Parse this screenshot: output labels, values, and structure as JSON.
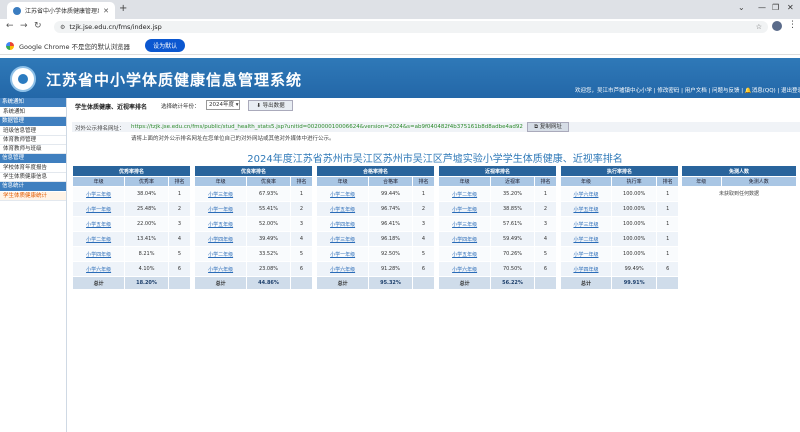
{
  "browser": {
    "tab_title": "江苏省中小学体质健康管理系...",
    "url": "tzjk.jse.edu.cn/fms/index.jsp",
    "infobar_message": "Google Chrome 不是您的默认浏览器",
    "infobar_button": "设为默认"
  },
  "app": {
    "title": "江苏省中小学体质健康信息管理系统",
    "userline": "欢迎您，吴江市芦墟镇中心小学 | 修改密码 | 用户文档 | 问题与反馈 | 🔔消息(QQ) | 退出登录"
  },
  "sidebar": {
    "sections": [
      {
        "head": "系统通知",
        "items": [
          "系统通知"
        ]
      },
      {
        "head": "数据管理",
        "items": [
          "班级信息管理",
          "体育教师管理",
          "体育教师与班级"
        ]
      },
      {
        "head": "信息管理",
        "items": [
          "学校体育年度报告",
          "学生体质健康信息"
        ]
      },
      {
        "head": "信息统计",
        "items": [
          "学生体质健康统计"
        ]
      }
    ]
  },
  "main": {
    "breadcrumb": "学生体质健康、近视率排名",
    "year_label": "选择统计年份：",
    "year_value": "2024年度",
    "export_button": "⬇ 导出数据",
    "url_label": "对外公示排名网址：",
    "url_value": "https://tzjk.jse.edu.cn/fms/public/stud_health_stats5.jsp?unitid=002000010006624&version=2024&s=ab9f040482f4b375161b8d8adbe4ad92",
    "copy_button": "复制网址",
    "url_note": "请将上面的对外公示排名网址在您单位自己的对外网站或其他对外媒体中进行公示。",
    "report_title": "2024年度江苏省苏州市吴江区苏州市吴江区芦墟实验小学学生体质健康、近视率排名"
  },
  "tables": [
    {
      "caption": "优秀率排名",
      "cols": [
        "年级",
        "优秀率",
        "排名"
      ],
      "rows": [
        [
          "小学三年级",
          "38.04%",
          "1"
        ],
        [
          "小学一年级",
          "25.48%",
          "2"
        ],
        [
          "小学五年级",
          "22.00%",
          "3"
        ],
        [
          "小学二年级",
          "13.41%",
          "4"
        ],
        [
          "小学四年级",
          "8.21%",
          "5"
        ],
        [
          "小学六年级",
          "4.10%",
          "6"
        ]
      ],
      "total": [
        "总计",
        "18.20%",
        ""
      ]
    },
    {
      "caption": "优良率排名",
      "cols": [
        "年级",
        "优良率",
        "排名"
      ],
      "rows": [
        [
          "小学三年级",
          "67.93%",
          "1"
        ],
        [
          "小学一年级",
          "55.41%",
          "2"
        ],
        [
          "小学五年级",
          "52.00%",
          "3"
        ],
        [
          "小学四年级",
          "39.49%",
          "4"
        ],
        [
          "小学二年级",
          "33.52%",
          "5"
        ],
        [
          "小学六年级",
          "23.08%",
          "6"
        ]
      ],
      "total": [
        "总计",
        "44.86%",
        ""
      ]
    },
    {
      "caption": "合格率排名",
      "cols": [
        "年级",
        "合格率",
        "排名"
      ],
      "rows": [
        [
          "小学二年级",
          "99.44%",
          "1"
        ],
        [
          "小学五年级",
          "96.74%",
          "2"
        ],
        [
          "小学四年级",
          "96.41%",
          "3"
        ],
        [
          "小学三年级",
          "96.18%",
          "4"
        ],
        [
          "小学一年级",
          "92.50%",
          "5"
        ],
        [
          "小学六年级",
          "91.28%",
          "6"
        ]
      ],
      "total": [
        "总计",
        "95.32%",
        ""
      ]
    },
    {
      "caption": "近视率排名",
      "cols": [
        "年级",
        "近视率",
        "排名"
      ],
      "rows": [
        [
          "小学二年级",
          "35.20%",
          "1"
        ],
        [
          "小学一年级",
          "38.85%",
          "2"
        ],
        [
          "小学三年级",
          "57.61%",
          "3"
        ],
        [
          "小学四年级",
          "59.49%",
          "4"
        ],
        [
          "小学五年级",
          "70.26%",
          "5"
        ],
        [
          "小学六年级",
          "70.50%",
          "6"
        ]
      ],
      "total": [
        "总计",
        "56.22%",
        ""
      ]
    },
    {
      "caption": "执行率排名",
      "cols": [
        "年级",
        "执行率",
        "排名"
      ],
      "rows": [
        [
          "小学六年级",
          "100.00%",
          "1"
        ],
        [
          "小学五年级",
          "100.00%",
          "1"
        ],
        [
          "小学三年级",
          "100.00%",
          "1"
        ],
        [
          "小学二年级",
          "100.00%",
          "1"
        ],
        [
          "小学一年级",
          "100.00%",
          "1"
        ],
        [
          "小学四年级",
          "99.49%",
          "6"
        ]
      ],
      "total": [
        "总计",
        "99.91%",
        ""
      ]
    }
  ],
  "exempt_table": {
    "caption": "免测人数",
    "cols": [
      "年级",
      "免测人数"
    ],
    "empty": "未获取到任何数据"
  }
}
